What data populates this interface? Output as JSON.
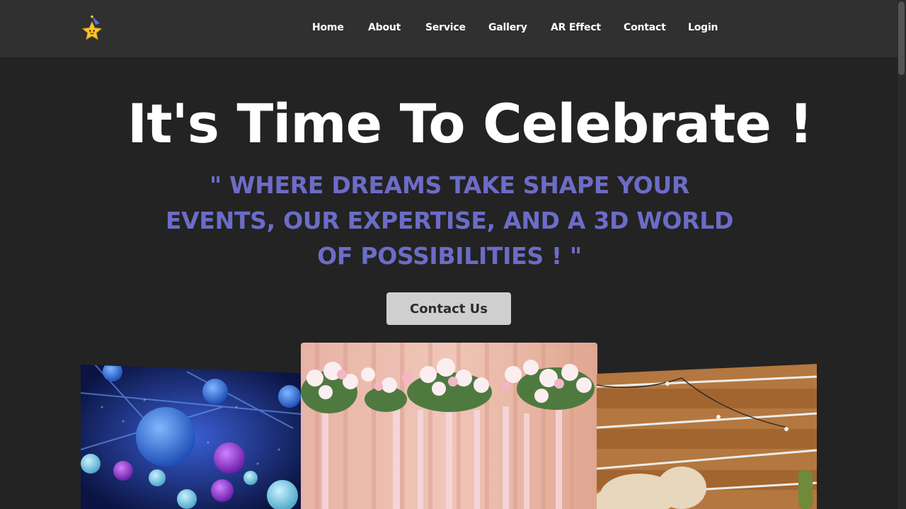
{
  "navbar": {
    "logo_icon": "star-with-party-hat-icon",
    "links": [
      {
        "label": "Home"
      },
      {
        "label": "About"
      },
      {
        "label": "Service"
      },
      {
        "label": "Gallery"
      },
      {
        "label": "AR Effect"
      },
      {
        "label": "Contact"
      },
      {
        "label": "Login"
      }
    ]
  },
  "hero": {
    "title": "It's Time To Celebrate !",
    "tagline": "\" WHERE DREAMS TAKE SHAPE YOUR EVENTS, OUR EXPERTISE, AND A 3D WORLD OF POSSIBILITIES ! \"",
    "contact_button": "Contact Us"
  },
  "gallery": {
    "photos": [
      {
        "subject": "blue-lantern-event-hall"
      },
      {
        "subject": "pink-floral-backdrop"
      },
      {
        "subject": "wooden-wall-pampas-decor"
      }
    ]
  },
  "colors": {
    "background": "#232323",
    "navbar": "#303030",
    "accent": "#6c6cc8",
    "button": "#cfcfcf"
  }
}
